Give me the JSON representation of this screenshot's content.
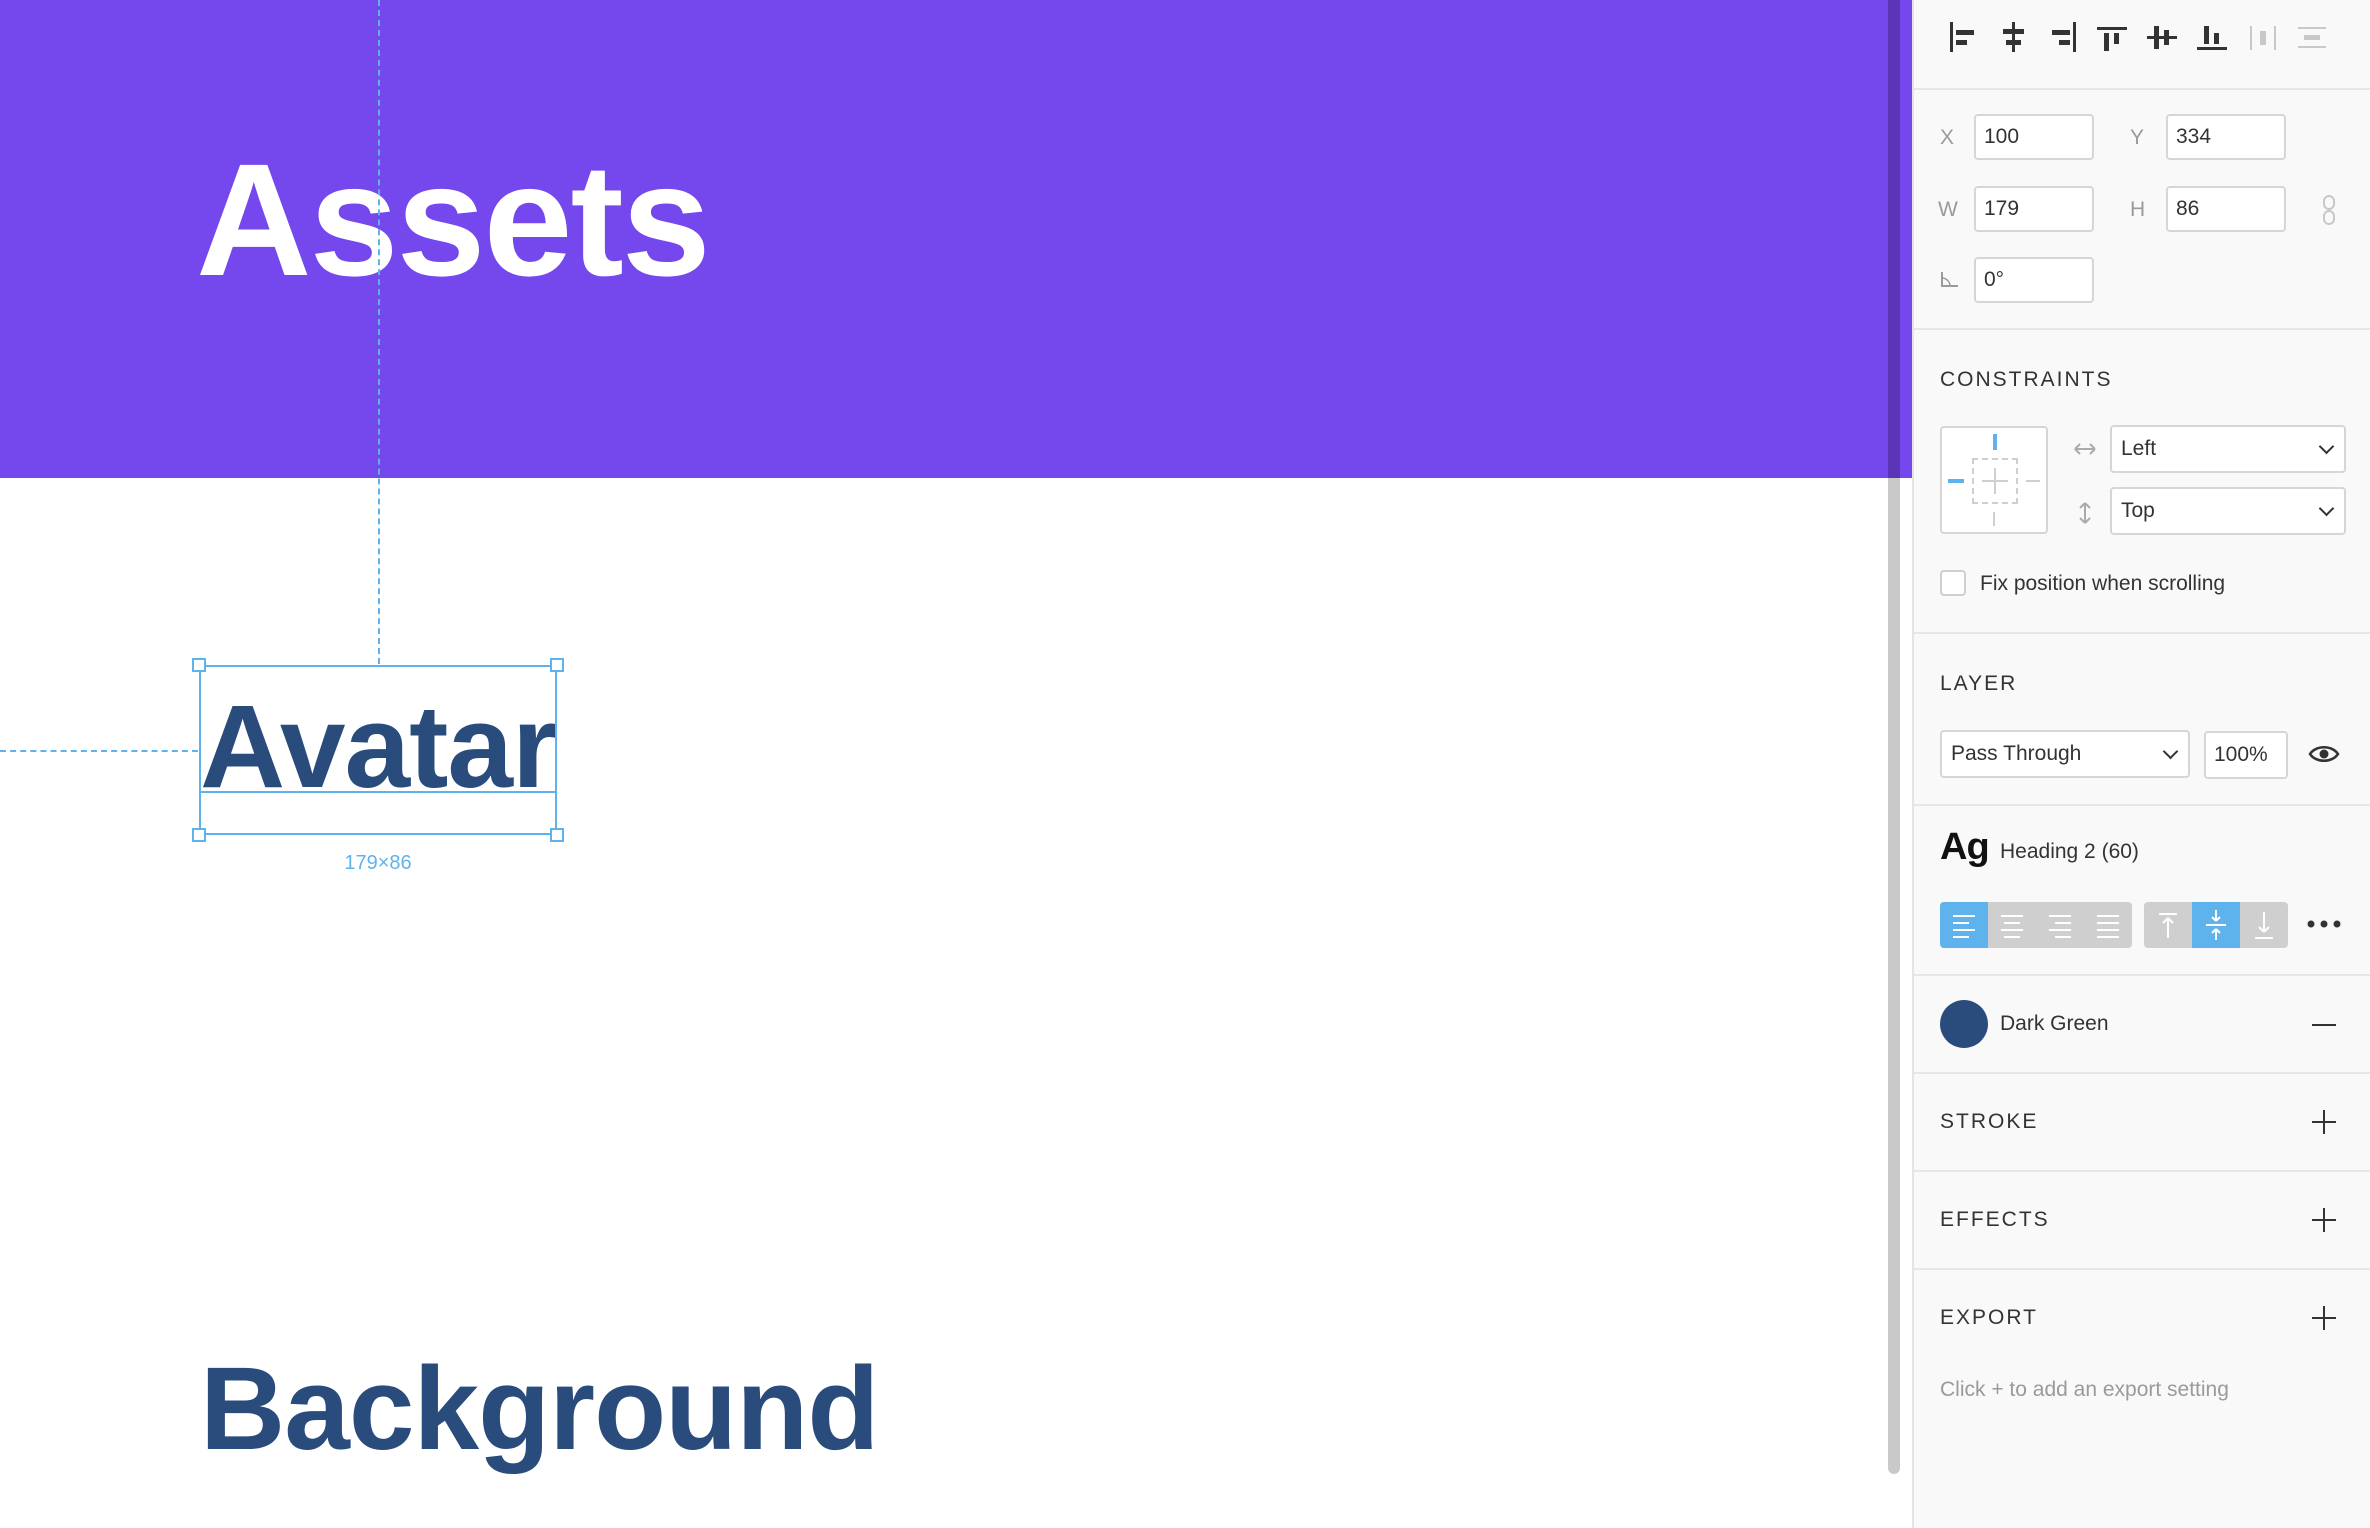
{
  "canvas": {
    "banner_title": "Assets",
    "selected_text": "Avatar",
    "selection_size": "179×86",
    "next_heading": "Background",
    "banner_color": "#7448ed",
    "text_color": "#2a4c7c",
    "selection_color": "#5fb3ec"
  },
  "panel": {
    "alignment_icons": [
      "align-left-icon",
      "align-horizontal-center-icon",
      "align-right-icon",
      "align-top-icon",
      "align-vertical-center-icon",
      "align-bottom-icon",
      "distribute-horizontal-icon",
      "distribute-vertical-icon"
    ],
    "position": {
      "x_label": "X",
      "x_value": "100",
      "y_label": "Y",
      "y_value": "334",
      "w_label": "W",
      "w_value": "179",
      "h_label": "H",
      "h_value": "86",
      "rotation_value": "0°"
    },
    "constraints": {
      "title": "CONSTRAINTS",
      "horizontal": "Left",
      "vertical": "Top",
      "fix_position_label": "Fix position when scrolling",
      "fix_position_checked": false
    },
    "layer": {
      "title": "LAYER",
      "blend_mode": "Pass Through",
      "opacity": "100%"
    },
    "text": {
      "preview": "Ag",
      "style_name": "Heading 2 (60)",
      "horizontal_align_selected": "left",
      "vertical_align_selected": "middle"
    },
    "fill": {
      "name": "Dark Green",
      "color": "#2a4c7c"
    },
    "stroke": {
      "title": "STROKE"
    },
    "effects": {
      "title": "EFFECTS"
    },
    "export": {
      "title": "EXPORT",
      "hint": "Click + to add an export setting"
    }
  }
}
